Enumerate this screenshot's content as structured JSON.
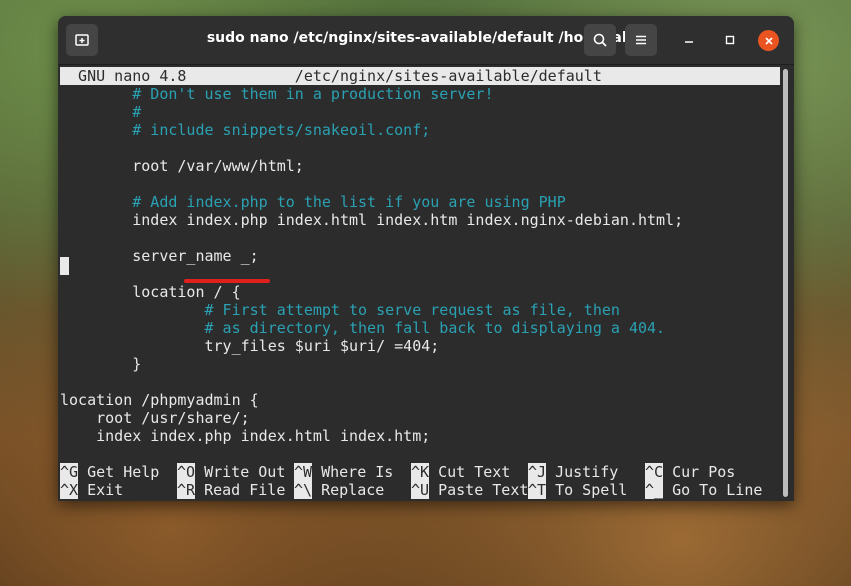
{
  "window": {
    "title": "sudo nano /etc/nginx/sites-available/default /home/alex"
  },
  "nano": {
    "header": "  GNU nano 4.8            /etc/nginx/sites-available/default",
    "lines": [
      {
        "text": "        # Don't use them in a production server!",
        "type": "comment"
      },
      {
        "text": "        #",
        "type": "comment"
      },
      {
        "text": "        # include snippets/snakeoil.conf;",
        "type": "comment"
      },
      {
        "text": "",
        "type": "code"
      },
      {
        "text": "        root /var/www/html;",
        "type": "code"
      },
      {
        "text": "",
        "type": "code"
      },
      {
        "text": "        # Add index.php to the list if you are using PHP",
        "type": "comment"
      },
      {
        "text": "        index index.php index.html index.htm index.nginx-debian.html;",
        "type": "code"
      },
      {
        "text": "",
        "type": "code"
      },
      {
        "text": "        server_name _;",
        "type": "code"
      },
      {
        "text": "",
        "type": "code"
      },
      {
        "text": "        location / {",
        "type": "code"
      },
      {
        "text": "                # First attempt to serve request as file, then",
        "type": "comment"
      },
      {
        "text": "                # as directory, then fall back to displaying a 404.",
        "type": "comment"
      },
      {
        "text": "                try_files $uri $uri/ =404;",
        "type": "code"
      },
      {
        "text": "        }",
        "type": "code"
      },
      {
        "text": "",
        "type": "code"
      },
      {
        "text": "location /phpmyadmin {",
        "type": "code"
      },
      {
        "text": "    root /usr/share/;",
        "type": "code"
      },
      {
        "text": "    index index.php index.html index.htm;",
        "type": "code"
      }
    ],
    "shortcuts": [
      [
        {
          "key": "^G",
          "label": " Get Help"
        },
        {
          "key": "^O",
          "label": " Write Out"
        },
        {
          "key": "^W",
          "label": " Where Is"
        },
        {
          "key": "^K",
          "label": " Cut Text"
        },
        {
          "key": "^J",
          "label": " Justify"
        },
        {
          "key": "^C",
          "label": " Cur Pos"
        }
      ],
      [
        {
          "key": "^X",
          "label": " Exit"
        },
        {
          "key": "^R",
          "label": " Read File"
        },
        {
          "key": "^\\",
          "label": " Replace"
        },
        {
          "key": "^U",
          "label": " Paste Text"
        },
        {
          "key": "^T",
          "label": " To Spell"
        },
        {
          "key": "^_",
          "label": " Go To Line"
        }
      ]
    ]
  },
  "colors": {
    "accent_close": "#e95420",
    "comment": "#2aa1b3",
    "annotation_underline": "#e0201c"
  }
}
